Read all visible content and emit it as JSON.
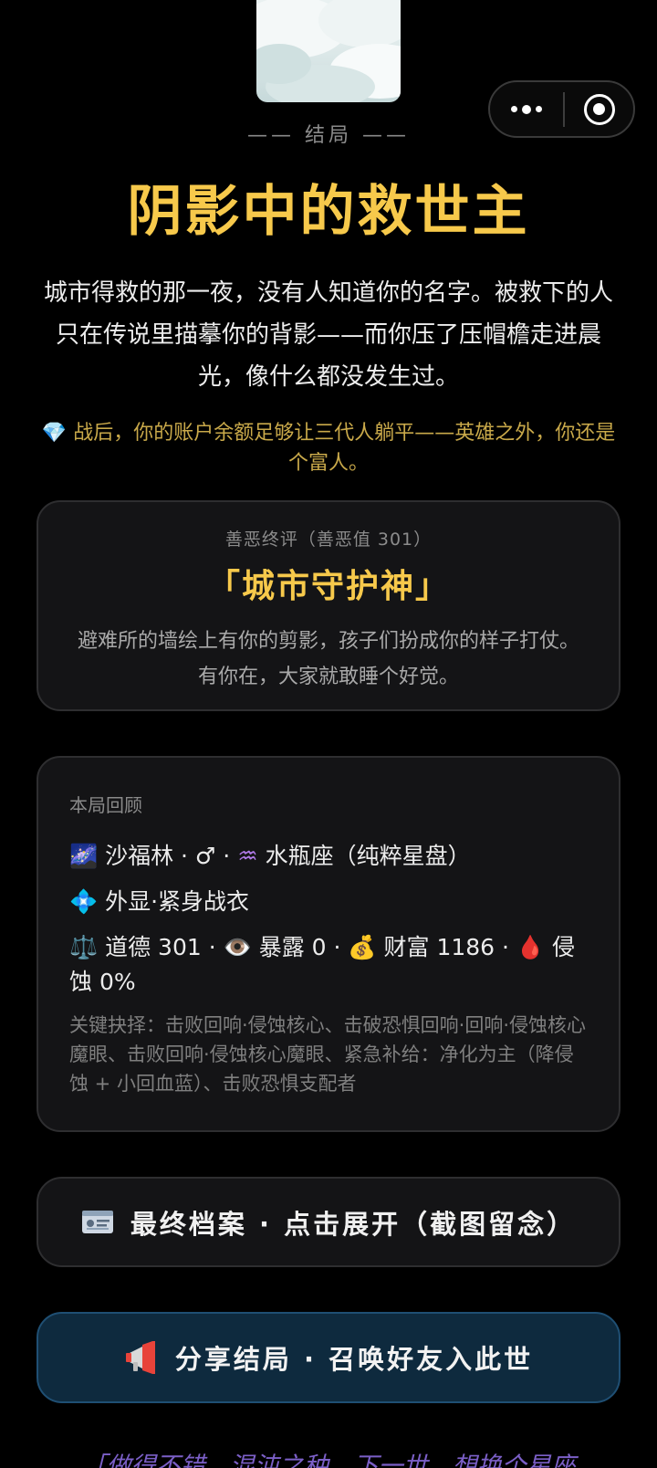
{
  "header": {
    "ending_label": "—— 结局 ——",
    "ending_title": "阴影中的救世主",
    "ending_desc": "城市得救的那一夜，没有人知道你的名字。被救下的人只在传说里描摹你的背影——而你压了压帽檐走进晨光，像什么都没发生过。",
    "wealth_icon": "💎",
    "wealth_note": "战后，你的账户余额足够让三代人躺平——英雄之外，你还是个富人。"
  },
  "verdict": {
    "label": "善恶终评（善恶值 301）",
    "title": "「城市守护神」",
    "desc": "避难所的墙绘上有你的剪影，孩子们扮成你的样子打仗。有你在，大家就敢睡个好觉。"
  },
  "review": {
    "label": "本局回顾",
    "identity_icon": "🌌",
    "identity_text": "沙福林 · ♂ · ",
    "zodiac_icon": "♒",
    "zodiac_text": "水瓶座（纯粹星盘）",
    "appearance_icon": "💠",
    "appearance_text": "外显·紧身战衣",
    "stats": {
      "morality_icon": "⚖️",
      "morality": "道德 301 · ",
      "exposure_icon": "👁️",
      "exposure": "暴露 0 · ",
      "wealth_icon": "💰",
      "wealth": "财富 1186 · ",
      "corruption_icon": "🩸",
      "corruption": "侵蚀 0%"
    },
    "key_choices": "关键抉择：击败回响·侵蚀核心、击破恐惧回响·回响·侵蚀核心魔眼、击败回响·侵蚀核心魔眼、紧急补给：净化为主（降侵蚀 + 小回血蓝）、击败恐惧支配者"
  },
  "buttons": {
    "archive_label": "最终档案 · 点击展开（截图留念）",
    "share_label": "分享结局 · 召唤好友入此世"
  },
  "bottom": {
    "left_link": "「做得不错，混沌之种",
    "right_link": "下一世，想换个星座"
  },
  "capsule": {
    "more_icon": "more-dots-icon",
    "close_icon": "target-close-icon"
  },
  "colors": {
    "title_gold": "#f7c94b",
    "wealth_gold": "#c9a94a",
    "card_bg": "#141416",
    "share_bg": "#0e2a3e",
    "link_purple": "#7b5fc7"
  }
}
